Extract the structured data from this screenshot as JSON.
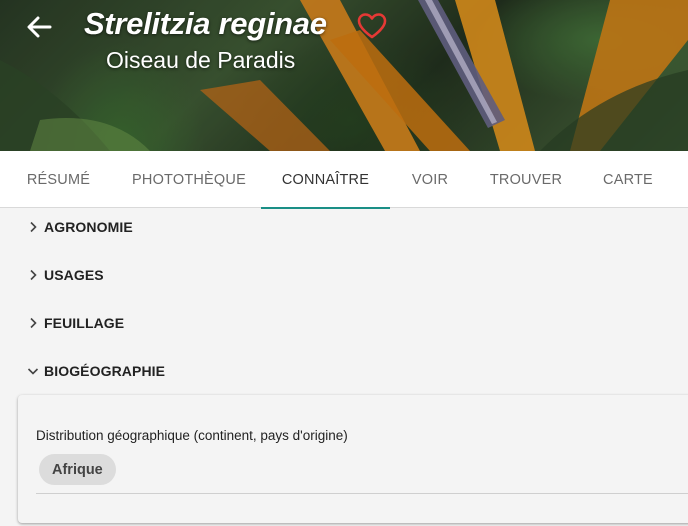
{
  "header": {
    "title": "Strelitzia reginae",
    "subtitle": "Oiseau de Paradis",
    "back_icon": "arrow-left-icon",
    "favorite_icon": "heart-outline-icon",
    "favorite_color": "#e53935"
  },
  "tabs": [
    {
      "label": "RÉSUMÉ",
      "active": false
    },
    {
      "label": "PHOTOTHÈQUE",
      "active": false
    },
    {
      "label": "CONNAÎTRE",
      "active": true
    },
    {
      "label": "VOIR",
      "active": false
    },
    {
      "label": "TROUVER",
      "active": false
    },
    {
      "label": "CARTE",
      "active": false
    }
  ],
  "accent_color": "#1a8f86",
  "sections": [
    {
      "label": "AGRONOMIE",
      "expanded": false
    },
    {
      "label": "USAGES",
      "expanded": false
    },
    {
      "label": "FEUILLAGE",
      "expanded": false
    },
    {
      "label": "BIOGÉOGRAPHIE",
      "expanded": true
    }
  ],
  "biogeography": {
    "field_label": "Distribution géographique (continent, pays d'origine)",
    "chips": [
      "Afrique"
    ]
  }
}
